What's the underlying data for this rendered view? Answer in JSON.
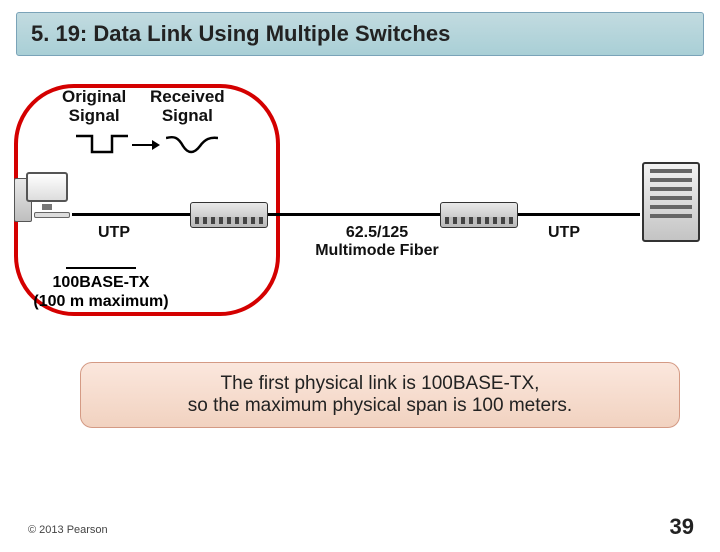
{
  "title": "5. 19: Data Link Using Multiple Switches",
  "signals": {
    "original_top": "Original",
    "original_bot": "Signal",
    "received_top": "Received",
    "received_bot": "Signal"
  },
  "links": {
    "utp1": "UTP",
    "middle_line1": "62.5/125",
    "middle_line2": "Multimode Fiber",
    "utp2": "UTP"
  },
  "left_standard": {
    "name": "100BASE-TX",
    "limit": "(100 m maximum)"
  },
  "callout": {
    "line1": "The first physical link is 100BASE-TX,",
    "line2": "so the maximum physical span is 100 meters."
  },
  "footer": {
    "copyright": "© 2013 Pearson",
    "page": "39"
  }
}
